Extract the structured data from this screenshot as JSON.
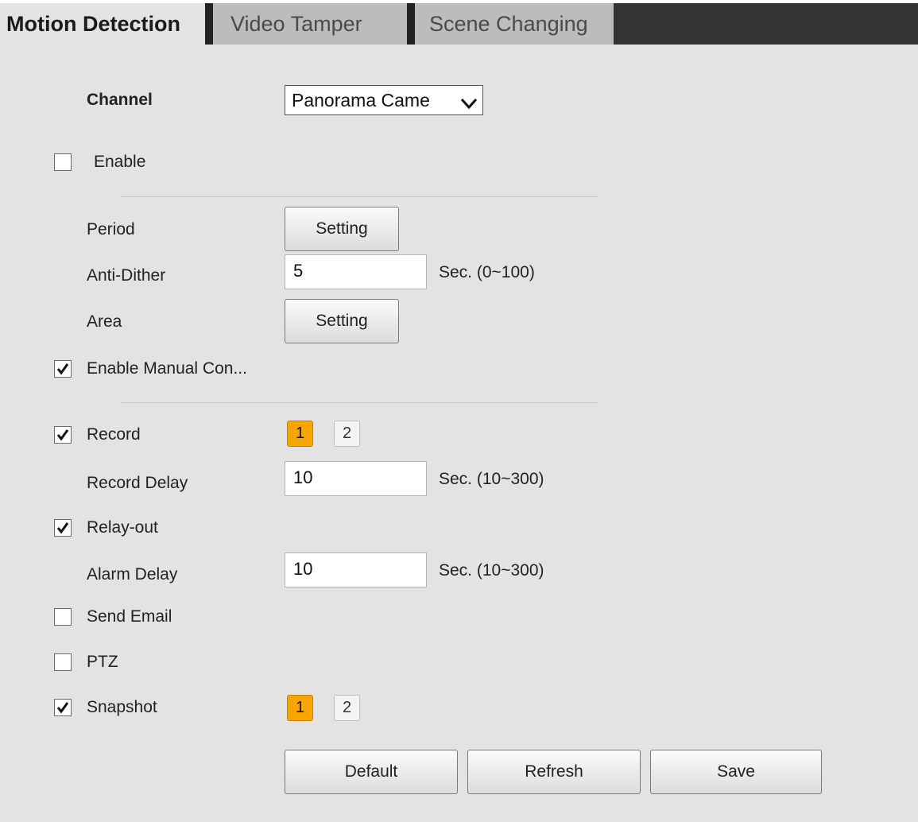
{
  "tabs": {
    "motion": "Motion Detection",
    "video": "Video Tamper",
    "scene": "Scene Changing"
  },
  "channel": {
    "label": "Channel",
    "value": "Panorama Came"
  },
  "enable": {
    "label": "Enable",
    "checked": false
  },
  "period": {
    "label": "Period",
    "button": "Setting"
  },
  "anti_dither": {
    "label": "Anti-Dither",
    "value": "5",
    "unit": "Sec. (0~100)"
  },
  "area": {
    "label": "Area",
    "button": "Setting"
  },
  "manual_control": {
    "label": "Enable Manual Con...",
    "checked": true
  },
  "record": {
    "label": "Record",
    "checked": true,
    "channels": [
      "1",
      "2"
    ],
    "selected": "1"
  },
  "record_delay": {
    "label": "Record Delay",
    "value": "10",
    "unit": "Sec. (10~300)"
  },
  "relay_out": {
    "label": "Relay-out",
    "checked": true
  },
  "alarm_delay": {
    "label": "Alarm Delay",
    "value": "10",
    "unit": "Sec. (10~300)"
  },
  "send_email": {
    "label": "Send Email",
    "checked": false
  },
  "ptz": {
    "label": "PTZ",
    "checked": false
  },
  "snapshot": {
    "label": "Snapshot",
    "checked": true,
    "channels": [
      "1",
      "2"
    ],
    "selected": "1"
  },
  "buttons": {
    "default": "Default",
    "refresh": "Refresh",
    "save": "Save"
  },
  "colors": {
    "active_channel": "#f7a600",
    "tab_bar_dark": "#333333",
    "background": "#e3e3e3"
  }
}
